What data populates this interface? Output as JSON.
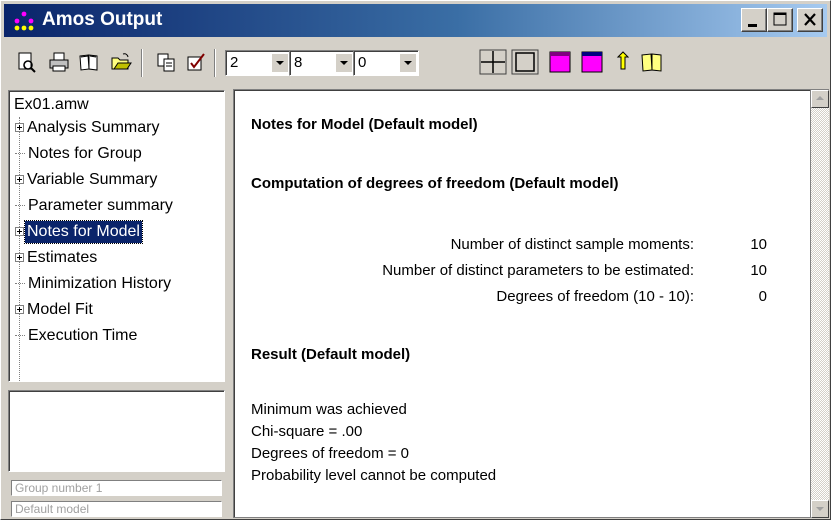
{
  "window": {
    "title": "Amos Output",
    "controls": {
      "minimize": "minimize-icon",
      "maximize": "maximize-icon",
      "close": "close-icon"
    }
  },
  "toolbar": {
    "icons": [
      "print-preview-icon",
      "print-icon",
      "book-icon",
      "open-folder-icon",
      "copy-icon",
      "checkbox-icon"
    ],
    "combo1": "2",
    "combo2": "8",
    "combo3": "0",
    "style_icons": [
      "grid-lines-icon",
      "box-icon",
      "magenta-box-icon",
      "magenta-box-2-icon",
      "pointer-help-icon",
      "help-book-icon"
    ]
  },
  "tree": {
    "root": "Ex01.amw",
    "items": [
      {
        "label": "Analysis Summary",
        "expandable": true,
        "selected": false
      },
      {
        "label": "Notes for Group",
        "expandable": false,
        "selected": false
      },
      {
        "label": "Variable Summary",
        "expandable": true,
        "selected": false
      },
      {
        "label": "Parameter summary",
        "expandable": false,
        "selected": false
      },
      {
        "label": "Notes for Model",
        "expandable": true,
        "selected": true
      },
      {
        "label": "Estimates",
        "expandable": true,
        "selected": false
      },
      {
        "label": "Minimization History",
        "expandable": false,
        "selected": false
      },
      {
        "label": "Model Fit",
        "expandable": true,
        "selected": false
      },
      {
        "label": "Execution Time",
        "expandable": false,
        "selected": false
      }
    ]
  },
  "lower_panel": {
    "group_label": "Group number 1",
    "model_label": "Default model"
  },
  "content": {
    "heading1": "Notes for Model (Default model)",
    "heading2": "Computation of degrees of freedom (Default model)",
    "rows": [
      {
        "label": "Number of distinct sample moments:",
        "value": "10"
      },
      {
        "label": "Number of distinct parameters to be estimated:",
        "value": "10"
      },
      {
        "label": "Degrees of freedom (10 - 10):",
        "value": "0"
      }
    ],
    "heading3": "Result (Default model)",
    "lines": [
      "Minimum was achieved",
      "Chi-square = .00",
      "Degrees of freedom = 0",
      "Probability level cannot be computed"
    ]
  },
  "colors": {
    "titlebar_start": "#0a246a",
    "titlebar_end": "#a6caf0",
    "selection": "#0a246a",
    "magenta": "#ff00ff"
  }
}
